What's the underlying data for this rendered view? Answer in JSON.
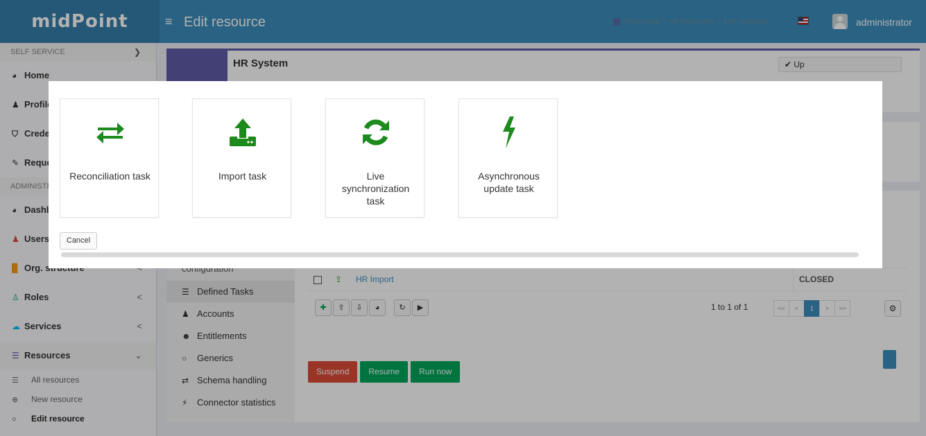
{
  "header": {
    "logo": "midPoint",
    "menu_icon": "hamburger-icon",
    "page_title": "Edit resource",
    "breadcrumb": [
      "Resources",
      "All resources",
      "Edit resource"
    ],
    "breadcrumb_sep": ">",
    "user": "administrator"
  },
  "sidebar": {
    "self_service_label": "SELF SERVICE",
    "self_service_items": [
      "Home",
      "Profile",
      "Credentials",
      "Requests"
    ],
    "admin_label": "ADMINISTRATION",
    "admin_items": [
      "Dashboards",
      "Users",
      "Org. structure",
      "Roles",
      "Services",
      "Resources"
    ],
    "resources_sub": [
      "All resources",
      "New resource",
      "Edit resource"
    ],
    "collapse_arrow": "<",
    "expand_arrow": "v"
  },
  "resource": {
    "name": "HR System",
    "status": "Up"
  },
  "tabs": {
    "config_partial": "configuration",
    "items": [
      "Defined Tasks",
      "Accounts",
      "Entitlements",
      "Generics",
      "Schema handling",
      "Connector statistics"
    ]
  },
  "tasks_table": {
    "row_name": "HR Import",
    "row_status": "CLOSED",
    "pager_info": "1 to 1 of 1",
    "pager": [
      "<<",
      "<",
      "1",
      ">",
      ">>"
    ]
  },
  "task_actions": {
    "suspend": "Suspend",
    "resume": "Resume",
    "run_now": "Run now"
  },
  "modal": {
    "cards": [
      {
        "label": "Reconciliation task",
        "icon": "exchange-icon"
      },
      {
        "label": "Import task",
        "icon": "upload-icon"
      },
      {
        "label": "Live synchronization task",
        "icon": "refresh-icon"
      },
      {
        "label": "Asynchronous update task",
        "icon": "bolt-icon"
      }
    ],
    "cancel": "Cancel"
  },
  "colors": {
    "header": "#3c8dbc",
    "logo_bg": "#367fa9",
    "resource_accent": "#605ca8",
    "icon_green": "#1d8a1d",
    "suspend": "#dd4b39",
    "resume": "#00a65a"
  }
}
